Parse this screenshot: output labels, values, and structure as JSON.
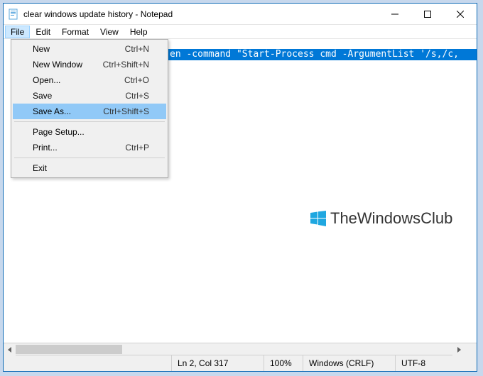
{
  "window": {
    "title": "clear windows update history - Notepad"
  },
  "menubar": {
    "items": [
      "File",
      "Edit",
      "Format",
      "View",
      "Help"
    ]
  },
  "dropdown": {
    "items": [
      {
        "label": "New",
        "shortcut": "Ctrl+N",
        "hl": false
      },
      {
        "label": "New Window",
        "shortcut": "Ctrl+Shift+N",
        "hl": false
      },
      {
        "label": "Open...",
        "shortcut": "Ctrl+O",
        "hl": false
      },
      {
        "label": "Save",
        "shortcut": "Ctrl+S",
        "hl": false
      },
      {
        "label": "Save As...",
        "shortcut": "Ctrl+Shift+S",
        "hl": true
      }
    ],
    "items2": [
      {
        "label": "Page Setup...",
        "shortcut": "",
        "hl": false
      },
      {
        "label": "Print...",
        "shortcut": "Ctrl+P",
        "hl": false
      }
    ],
    "items3": [
      {
        "label": "Exit",
        "shortcut": "",
        "hl": false
      }
    ]
  },
  "editor": {
    "visible_text": "en -command \"Start-Process cmd -ArgumentList '/s,/c,"
  },
  "watermark": {
    "text": "TheWindowsClub"
  },
  "statusbar": {
    "position": "Ln 2, Col 317",
    "zoom": "100%",
    "lineending": "Windows (CRLF)",
    "encoding": "UTF-8"
  }
}
